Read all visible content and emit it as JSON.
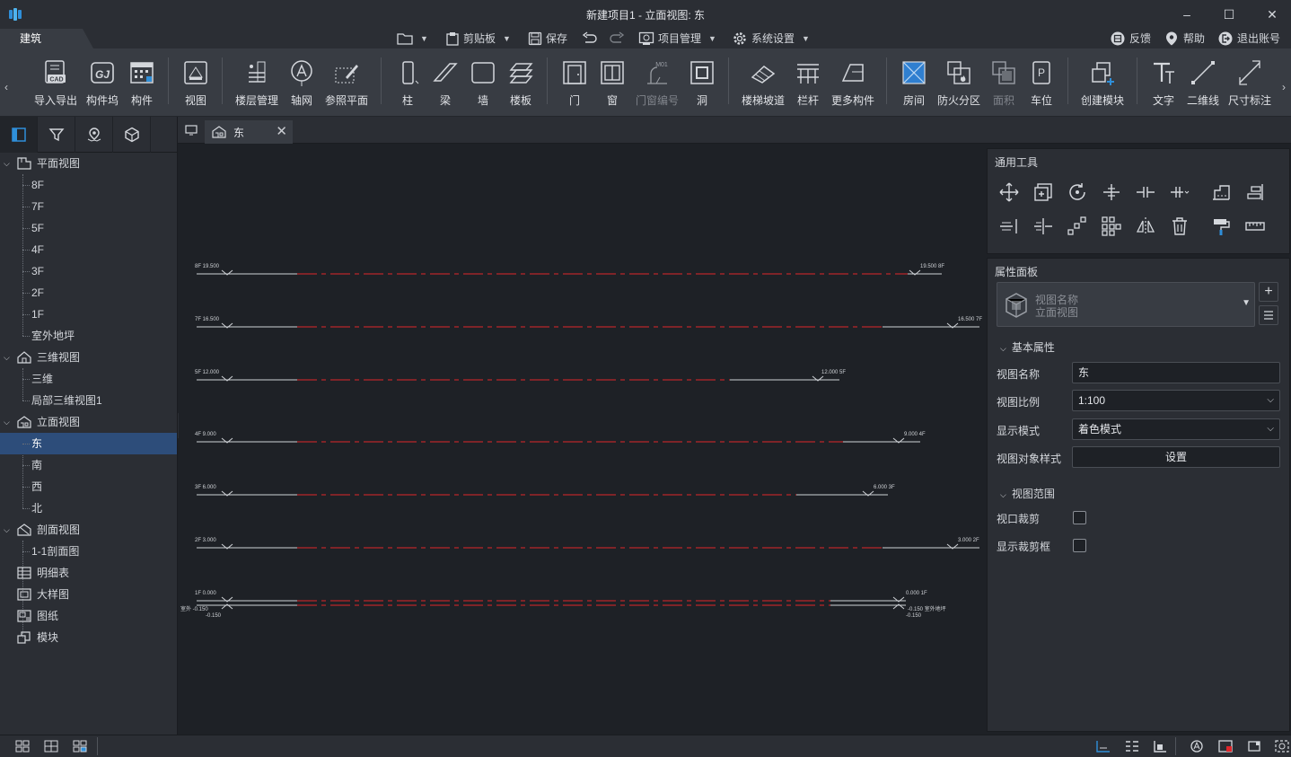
{
  "window": {
    "title": "新建项目1 - 立面视图: 东",
    "minimize": "–",
    "maximize": "☐",
    "close": "✕"
  },
  "quick_access": {
    "active_tab": "建筑",
    "clipboard": "剪贴板",
    "save": "保存",
    "project_mgmt": "项目管理",
    "system_settings": "系统设置",
    "feedback": "反馈",
    "help": "帮助",
    "logout": "退出账号"
  },
  "ribbon": {
    "items": [
      {
        "label": "导入导出",
        "icon": "cad-icon"
      },
      {
        "label": "构件坞",
        "icon": "gj-icon"
      },
      {
        "label": "构件",
        "icon": "component-icon"
      },
      {
        "label": "视图",
        "icon": "view-icon"
      },
      {
        "label": "楼层管理",
        "icon": "floor-manage-icon"
      },
      {
        "label": "轴网",
        "icon": "axis-grid-icon"
      },
      {
        "label": "参照平面",
        "icon": "ref-plane-icon"
      },
      {
        "label": "柱",
        "icon": "column-icon"
      },
      {
        "label": "梁",
        "icon": "beam-icon"
      },
      {
        "label": "墙",
        "icon": "wall-icon"
      },
      {
        "label": "楼板",
        "icon": "slab-icon"
      },
      {
        "label": "门",
        "icon": "door-icon"
      },
      {
        "label": "窗",
        "icon": "window-icon"
      },
      {
        "label": "门窗编号",
        "icon": "door-window-tag-icon"
      },
      {
        "label": "洞",
        "icon": "opening-icon"
      },
      {
        "label": "楼梯坡道",
        "icon": "stair-icon"
      },
      {
        "label": "栏杆",
        "icon": "railing-icon"
      },
      {
        "label": "更多构件",
        "icon": "more-components-icon"
      },
      {
        "label": "房间",
        "icon": "room-icon"
      },
      {
        "label": "防火分区",
        "icon": "fire-zone-icon"
      },
      {
        "label": "面积",
        "icon": "area-icon"
      },
      {
        "label": "车位",
        "icon": "parking-icon"
      },
      {
        "label": "创建模块",
        "icon": "create-module-icon"
      },
      {
        "label": "文字",
        "icon": "text-icon"
      },
      {
        "label": "二维线",
        "icon": "line-2d-icon"
      },
      {
        "label": "尺寸标注",
        "icon": "dimension-icon"
      }
    ],
    "tag_text": "M01"
  },
  "tree": {
    "groups": [
      {
        "label": "平面视图",
        "children": [
          "8F",
          "7F",
          "5F",
          "4F",
          "3F",
          "2F",
          "1F",
          "室外地坪"
        ]
      },
      {
        "label": "三维视图",
        "children": [
          "三维",
          "局部三维视图1"
        ]
      },
      {
        "label": "立面视图",
        "children": [
          "东",
          "南",
          "西",
          "北"
        ]
      },
      {
        "label": "剖面视图",
        "children": [
          "1-1剖面图"
        ]
      }
    ],
    "leaves": [
      "明细表",
      "大样图",
      "图纸",
      "模块"
    ],
    "selected": "东"
  },
  "doc_tab": {
    "label": "东"
  },
  "general_tools": {
    "title": "通用工具"
  },
  "properties": {
    "title": "属性面板",
    "type_name": "视图名称",
    "type_value": "立面视图",
    "section_basic": "基本属性",
    "view_name_label": "视图名称",
    "view_name_value": "东",
    "view_scale_label": "视图比例",
    "view_scale_value": "1:100",
    "display_mode_label": "显示模式",
    "display_mode_value": "着色模式",
    "object_style_label": "视图对象样式",
    "object_style_button": "设置",
    "section_range": "视图范围",
    "crop_label": "视口裁剪",
    "show_crop_label": "显示裁剪框"
  },
  "colors": {
    "accent_selection": "#2d4d7a",
    "level_line": "#e0262b",
    "background": "#1e2126"
  }
}
